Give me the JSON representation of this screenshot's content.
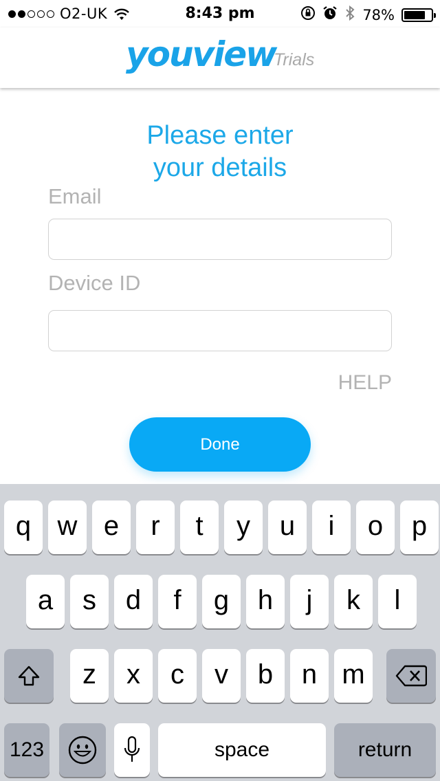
{
  "status_bar": {
    "carrier": "O2-UK",
    "time": "8:43 pm",
    "battery_percent": "78%",
    "battery_level": 0.78,
    "signal_bars_filled": 2,
    "signal_bars_total": 5
  },
  "header": {
    "logo_text": "youview",
    "logo_suffix": "Trials"
  },
  "form": {
    "title_line1": "Please enter",
    "title_line2": "your details",
    "email_label": "Email",
    "email_value": "",
    "device_id_label": "Device ID",
    "device_id_value": "",
    "help_label": "HELP",
    "done_label": "Done"
  },
  "keyboard": {
    "row1": [
      "q",
      "w",
      "e",
      "r",
      "t",
      "y",
      "u",
      "i",
      "o",
      "p"
    ],
    "row2": [
      "a",
      "s",
      "d",
      "f",
      "g",
      "h",
      "j",
      "k",
      "l"
    ],
    "row3": [
      "z",
      "x",
      "c",
      "v",
      "b",
      "n",
      "m"
    ],
    "numbers_label": "123",
    "space_label": "space",
    "return_label": "return"
  },
  "colors": {
    "accent": "#09a9f5",
    "title": "#1ca8e8",
    "label_gray": "#b3b3b3",
    "keyboard_bg": "#d1d4d9"
  }
}
